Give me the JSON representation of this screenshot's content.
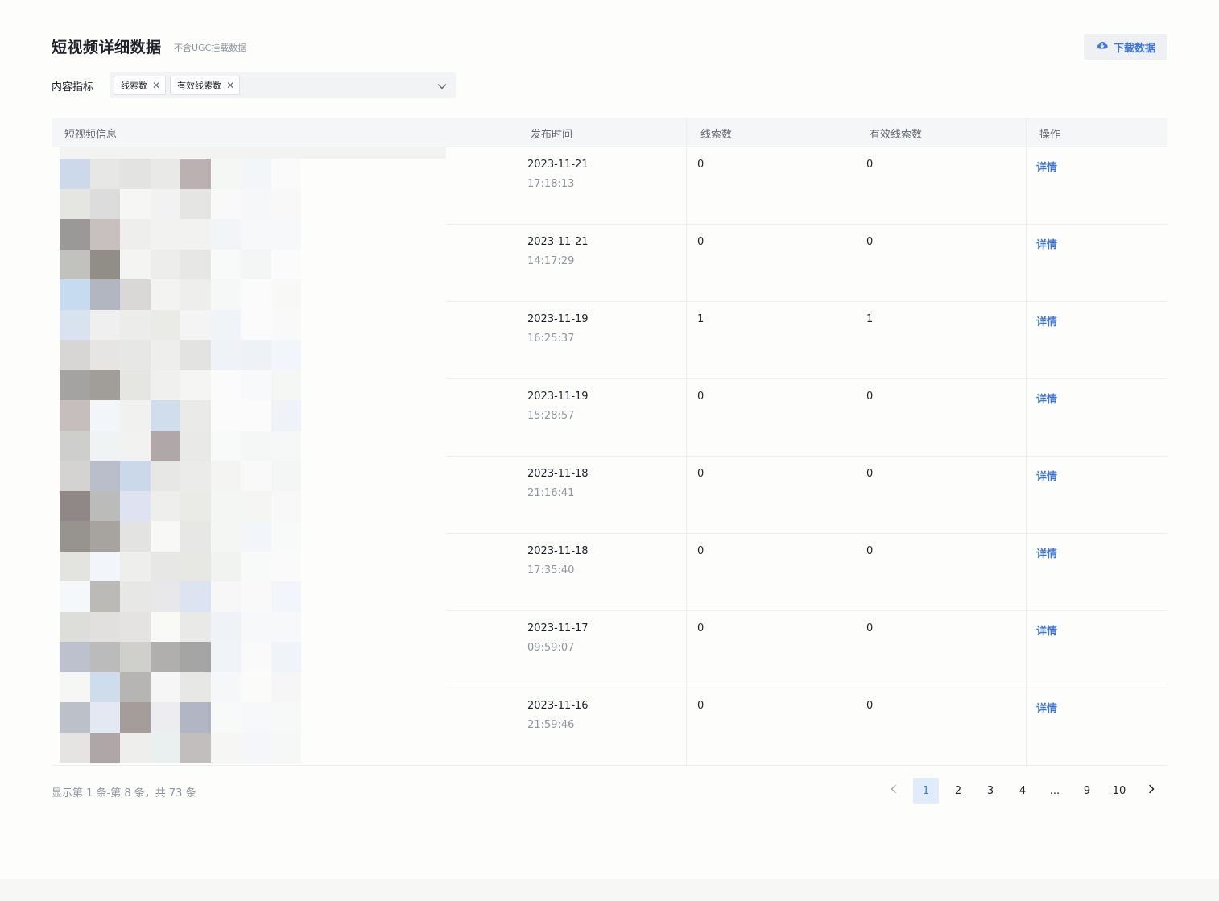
{
  "header": {
    "title": "短视频详细数据",
    "subtitle": "不含UGC挂载数据",
    "download_label": "下载数据"
  },
  "filter": {
    "label": "内容指标",
    "tags": [
      "线索数",
      "有效线索数"
    ]
  },
  "table": {
    "columns": [
      "短视频信息",
      "发布时间",
      "线索数",
      "有效线索数",
      "操作"
    ],
    "rows": [
      {
        "date": "2023-11-21",
        "time": "17:18:13",
        "leads": "0",
        "valid_leads": "0",
        "action": "详情"
      },
      {
        "date": "2023-11-21",
        "time": "14:17:29",
        "leads": "0",
        "valid_leads": "0",
        "action": "详情"
      },
      {
        "date": "2023-11-19",
        "time": "16:25:37",
        "leads": "1",
        "valid_leads": "1",
        "action": "详情"
      },
      {
        "date": "2023-11-19",
        "time": "15:28:57",
        "leads": "0",
        "valid_leads": "0",
        "action": "详情"
      },
      {
        "date": "2023-11-18",
        "time": "21:16:41",
        "leads": "0",
        "valid_leads": "0",
        "action": "详情"
      },
      {
        "date": "2023-11-18",
        "time": "17:35:40",
        "leads": "0",
        "valid_leads": "0",
        "action": "详情"
      },
      {
        "date": "2023-11-17",
        "time": "09:59:07",
        "leads": "0",
        "valid_leads": "0",
        "action": "详情"
      },
      {
        "date": "2023-11-16",
        "time": "21:59:46",
        "leads": "0",
        "valid_leads": "0",
        "action": "详情"
      }
    ]
  },
  "pagination": {
    "summary": "显示第 1 条-第 8 条，共 73 条",
    "pages": [
      "1",
      "2",
      "3",
      "4",
      "...",
      "9",
      "10"
    ],
    "current": "1"
  },
  "colors": {
    "accent": "#3d76d8",
    "active_page_bg": "#e1ecfb"
  }
}
